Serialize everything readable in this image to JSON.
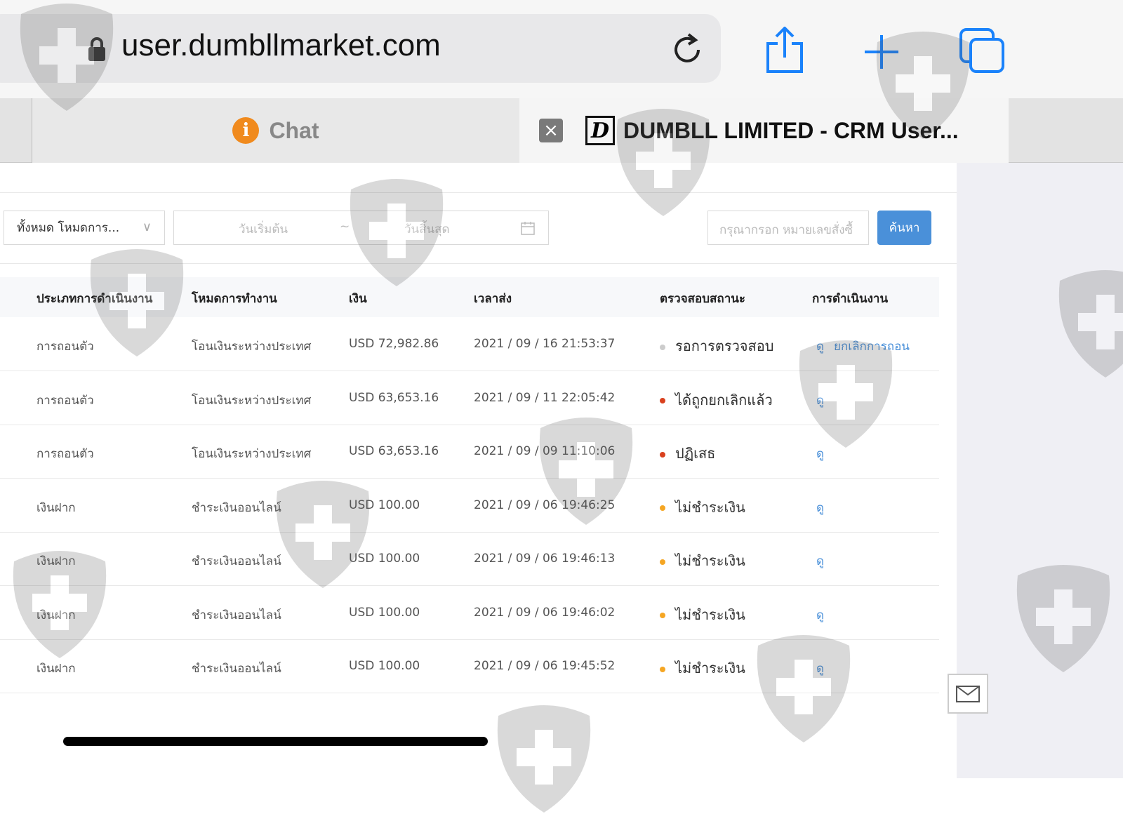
{
  "browser": {
    "url": "user.dumbllmarket.com",
    "tabs": [
      {
        "label": "Chat"
      },
      {
        "label": "DUMBLL LIMITED - CRM User..."
      }
    ]
  },
  "filters": {
    "mode_select": "ทั้งหมด โหมดการ...",
    "start_date_placeholder": "วันเริ่มต้น",
    "separator": "~",
    "end_date_placeholder": "วันสิ้นสุด",
    "search_placeholder": "กรุณากรอก หมายเลขสั่งซื้",
    "search_button": "ค้นหา"
  },
  "table": {
    "headers": [
      "ประเภทการดำเนินงาน",
      "โหมดการทำงาน",
      "เงิน",
      "เวลาส่ง",
      "ตรวจสอบสถานะ",
      "การดำเนินงาน"
    ],
    "rows": [
      {
        "type": "การถอนตัว",
        "mode": "โอนเงินระหว่างประเทศ",
        "amount": "USD 72,982.86",
        "time": "2021 / 09 / 16 21:53:37",
        "status": "รอการตรวจสอบ",
        "status_color": "#cccccc",
        "view": "ดู",
        "cancel": "ยกเลิกการถอน"
      },
      {
        "type": "การถอนตัว",
        "mode": "โอนเงินระหว่างประเทศ",
        "amount": "USD 63,653.16",
        "time": "2021 / 09 / 11 22:05:42",
        "status": "ได้ถูกยกเลิกแล้ว",
        "status_color": "#d9411e",
        "view": "ดู"
      },
      {
        "type": "การถอนตัว",
        "mode": "โอนเงินระหว่างประเทศ",
        "amount": "USD 63,653.16",
        "time": "2021 / 09 / 09 11:10:06",
        "status": "ปฏิเสธ",
        "status_color": "#d9411e",
        "view": "ดู"
      },
      {
        "type": "เงินฝาก",
        "mode": "ชำระเงินออนไลน์",
        "amount": "USD 100.00",
        "time": "2021 / 09 / 06 19:46:25",
        "status": "ไม่ชำระเงิน",
        "status_color": "#f5a623",
        "view": "ดู"
      },
      {
        "type": "เงินฝาก",
        "mode": "ชำระเงินออนไลน์",
        "amount": "USD 100.00",
        "time": "2021 / 09 / 06 19:46:13",
        "status": "ไม่ชำระเงิน",
        "status_color": "#f5a623",
        "view": "ดู"
      },
      {
        "type": "เงินฝาก",
        "mode": "ชำระเงินออนไลน์",
        "amount": "USD 100.00",
        "time": "2021 / 09 / 06 19:46:02",
        "status": "ไม่ชำระเงิน",
        "status_color": "#f5a623",
        "view": "ดู"
      },
      {
        "type": "เงินฝาก",
        "mode": "ชำระเงินออนไลน์",
        "amount": "USD 100.00",
        "time": "2021 / 09 / 06 19:45:52",
        "status": "ไม่ชำระเงิน",
        "status_color": "#f5a623",
        "view": "ดู"
      }
    ]
  }
}
